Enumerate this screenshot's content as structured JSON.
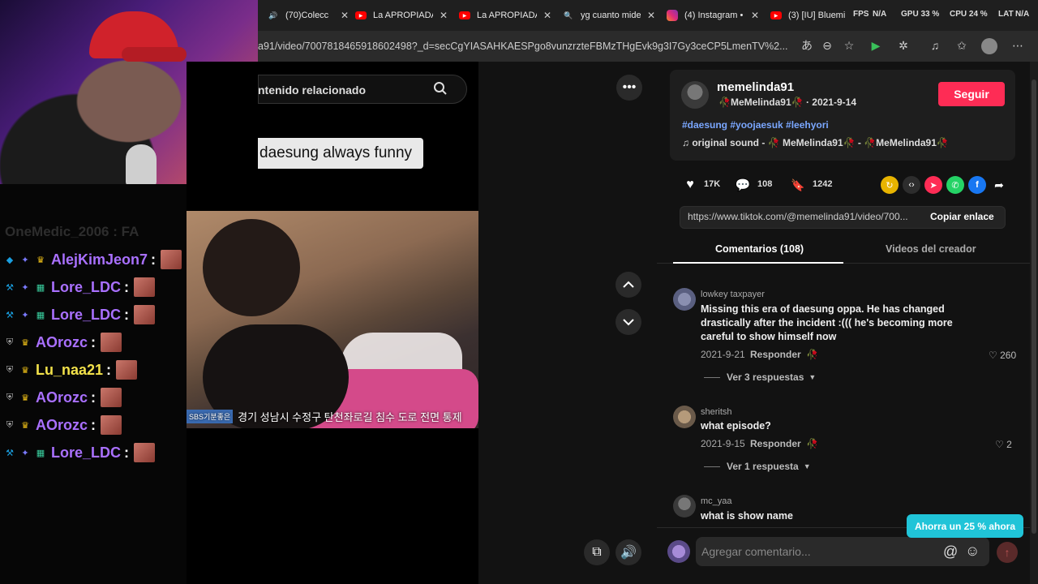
{
  "browser": {
    "tabs": [
      {
        "label": "(70)Colecc",
        "icon": "speaker-icon"
      },
      {
        "label": "La APROPIADA",
        "icon": "youtube-icon"
      },
      {
        "label": "La APROPIADA",
        "icon": "youtube-icon"
      },
      {
        "label": "yg cuanto mide",
        "icon": "search-icon"
      },
      {
        "label": "(4) Instagram •",
        "icon": "instagram-icon"
      },
      {
        "label": "(3) [IU] Bluemi",
        "icon": "youtube-icon"
      }
    ],
    "stats": {
      "fps": "FPS",
      "fps_val": "N/A",
      "gpu": "GPU 33 %",
      "cpu": "CPU 24 %",
      "lat": "LAT",
      "lat_val": "N/A"
    },
    "url": "a91/video/7007818465918602498?_d=secCgYIASAHKAESPgo8vunzrzteFBMzTHgEvk9g3I7Gy3ceCP5LmenTV%2..."
  },
  "chat": {
    "ghost_line": "OneMedic_2006 : FA",
    "messages": [
      {
        "user": "AlejKimJeon7",
        "color": "#a970ff",
        "badges": [
          "cube",
          "star",
          "crown"
        ]
      },
      {
        "user": "Lore_LDC",
        "color": "#a970ff",
        "badges": [
          "hammer",
          "star",
          "grid"
        ]
      },
      {
        "user": "Lore_LDC",
        "color": "#a970ff",
        "badges": [
          "hammer",
          "star",
          "grid"
        ]
      },
      {
        "user": "AOrozc",
        "color": "#a970ff",
        "badges": [
          "shield",
          "crown"
        ]
      },
      {
        "user": "Lu_naa21",
        "color": "#f2e14a",
        "badges": [
          "shield",
          "crown"
        ]
      },
      {
        "user": "AOrozc",
        "color": "#a970ff",
        "badges": [
          "shield",
          "crown"
        ]
      },
      {
        "user": "AOrozc",
        "color": "#a970ff",
        "badges": [
          "shield",
          "crown"
        ]
      },
      {
        "user": "Lore_LDC",
        "color": "#a970ff",
        "badges": [
          "hammer",
          "star",
          "grid"
        ]
      }
    ]
  },
  "video": {
    "search_placeholder": "ntenido relacionado",
    "caption": "daesung always funny",
    "subtitle_chip": "SBS기분좋은",
    "subtitle": "경기 성남시 수정구 탄천좌로길 침수 도로 전면 통제"
  },
  "post": {
    "username": "memelinda91",
    "display_name": "MeMelinda91",
    "date": "2021-9-14",
    "follow_label": "Seguir",
    "hashtags": "#daesung #yoojaesuk #leehyori",
    "sound": "original sound - 🥀 MeMelinda91🥀 - 🥀MeMelinda91🥀",
    "likes": "17K",
    "comments": "108",
    "saves": "1242",
    "share_url": "https://www.tiktok.com/@memelinda91/video/700...",
    "copy_label": "Copiar enlace",
    "tab_comments": "Comentarios (108)",
    "tab_videos": "Videos del creador"
  },
  "comments": [
    {
      "user": "lowkey taxpayer",
      "lines": [
        "Missing this era of daesung oppa. He has changed",
        "drastically after the incident :((( he's becoming more",
        "careful to show himself now"
      ],
      "date": "2021-9-21",
      "reply": "Responder",
      "likes": "260",
      "more": "Ver 3 respuestas"
    },
    {
      "user": "sheritsh",
      "lines": [
        "what episode?"
      ],
      "date": "2021-9-15",
      "reply": "Responder",
      "likes": "2",
      "more": "Ver 1 respuesta"
    },
    {
      "user": "mc_yaa",
      "lines": [
        "what is show name"
      ]
    }
  ],
  "promo": "Ahorra un 25 % ahora",
  "comment_placeholder": "Agregar comentario..."
}
